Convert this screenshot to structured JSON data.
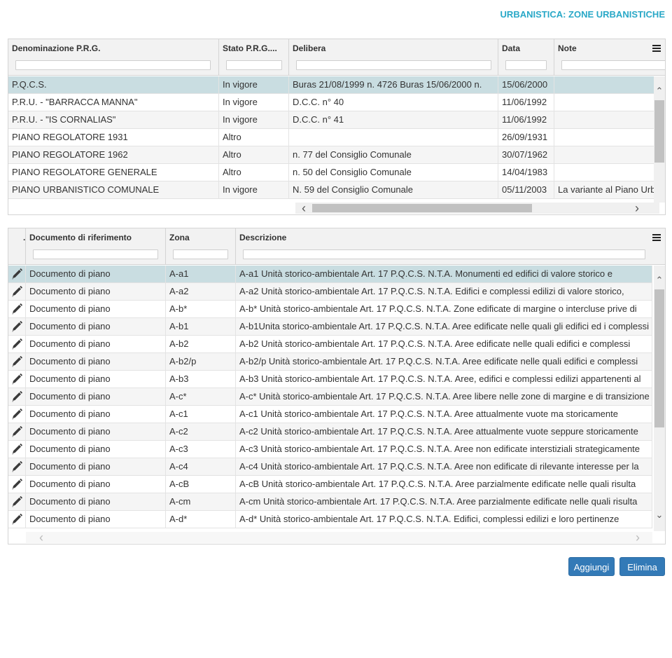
{
  "page": {
    "title": "URBANISTICA: ZONE URBANISTICHE"
  },
  "grid1": {
    "columns": [
      "Denominazione P.R.G.",
      "Stato P.R.G....",
      "Delibera",
      "Data",
      "Note"
    ],
    "rows": [
      [
        "P.Q.C.S.",
        "In vigore",
        "Buras 21/08/1999 n. 4726 Buras 15/06/2000 n.",
        "15/06/2000",
        ""
      ],
      [
        "P.R.U. - \"BARRACCA MANNA\"",
        "In vigore",
        "D.C.C. n° 40",
        "11/06/1992",
        ""
      ],
      [
        "P.R.U. - \"IS CORNALIAS\"",
        "In vigore",
        "D.C.C. n° 41",
        "11/06/1992",
        ""
      ],
      [
        "PIANO REGOLATORE 1931",
        "Altro",
        "",
        "26/09/1931",
        ""
      ],
      [
        "PIANO REGOLATORE 1962",
        "Altro",
        "n. 77 del Consiglio Comunale",
        "30/07/1962",
        ""
      ],
      [
        "PIANO REGOLATORE GENERALE",
        "Altro",
        "n. 50 del Consiglio Comunale",
        "14/04/1983",
        ""
      ],
      [
        "PIANO URBANISTICO COMUNALE",
        "In vigore",
        "N. 59 del Consiglio Comunale",
        "05/11/2003",
        "La variante al Piano Urb"
      ]
    ],
    "selected_row": 0
  },
  "grid2": {
    "columns": [
      ".",
      "Documento di riferimento",
      "Zona",
      "Descrizione"
    ],
    "rows": [
      [
        "Documento di piano",
        "A-a1",
        "A-a1 Unità storico-ambientale Art. 17 P.Q.C.S. N.T.A. Monumenti ed edifici di valore storico e"
      ],
      [
        "Documento di piano",
        "A-a2",
        "A-a2 Unità storico-ambientale Art. 17 P.Q.C.S. N.T.A. Edifici e complessi edilizi di valore storico,"
      ],
      [
        "Documento di piano",
        "A-b*",
        "A-b* Unità storico-ambientale Art. 17 P.Q.C.S. N.T.A. Zone edificate di margine o intercluse prive di"
      ],
      [
        "Documento di piano",
        "A-b1",
        "A-b1Unita storico-ambientale Art. 17 P.Q.C.S. N.T.A. Aree edificate nelle quali gli edifici ed i complessi"
      ],
      [
        "Documento di piano",
        "A-b2",
        "A-b2 Unità storico-ambientale Art. 17 P.Q.C.S. N.T.A. Aree edificate nelle quali edifici e complessi"
      ],
      [
        "Documento di piano",
        "A-b2/p",
        "A-b2/p Unità storico-ambientale Art. 17 P.Q.C.S. N.T.A. Aree edificate nelle quali edifici e complessi"
      ],
      [
        "Documento di piano",
        "A-b3",
        "A-b3 Unità storico-ambientale Art. 17 P.Q.C.S. N.T.A. Aree, edifici e complessi edilizi appartenenti al"
      ],
      [
        "Documento di piano",
        "A-c*",
        "A-c* Unità storico-ambientale Art. 17 P.Q.C.S. N.T.A. Aree libere nelle zone di margine e di transizione"
      ],
      [
        "Documento di piano",
        "A-c1",
        "A-c1 Unità storico-ambientale Art. 17 P.Q.C.S. N.T.A. Aree attualmente vuote ma storicamente"
      ],
      [
        "Documento di piano",
        "A-c2",
        "A-c2 Unità storico-ambientale Art. 17 P.Q.C.S. N.T.A. Aree attualmente vuote seppure storicamente"
      ],
      [
        "Documento di piano",
        "A-c3",
        "A-c3 Unità storico-ambientale Art. 17 P.Q.C.S. N.T.A. Aree non edificate interstiziali strategicamente"
      ],
      [
        "Documento di piano",
        "A-c4",
        "A-c4 Unità storico-ambientale Art. 17 P.Q.C.S. N.T.A. Aree non edificate di rilevante interesse per la"
      ],
      [
        "Documento di piano",
        "A-cB",
        "A-cB Unità storico-ambientale Art. 17 P.Q.C.S. N.T.A. Aree parzialmente edificate nelle quali risulta"
      ],
      [
        "Documento di piano",
        "A-cm",
        "A-cm Unità storico-ambientale Art. 17 P.Q.C.S. N.T.A. Aree parzialmente edificate nelle quali risulta"
      ],
      [
        "Documento di piano",
        "A-d*",
        "A-d* Unità storico-ambientale Art. 17 P.Q.C.S. N.T.A. Edifici, complessi edilizi e loro pertinenze"
      ]
    ],
    "selected_row": 0
  },
  "buttons": {
    "add": "Aggiungi",
    "delete": "Elimina"
  },
  "icons": {
    "row_action": "pencil-icon",
    "column_menu": "hamburger-menu-icon"
  },
  "colors": {
    "title": "#29a8c7",
    "selected_row": "#c9dde1",
    "button": "#337ab7"
  }
}
